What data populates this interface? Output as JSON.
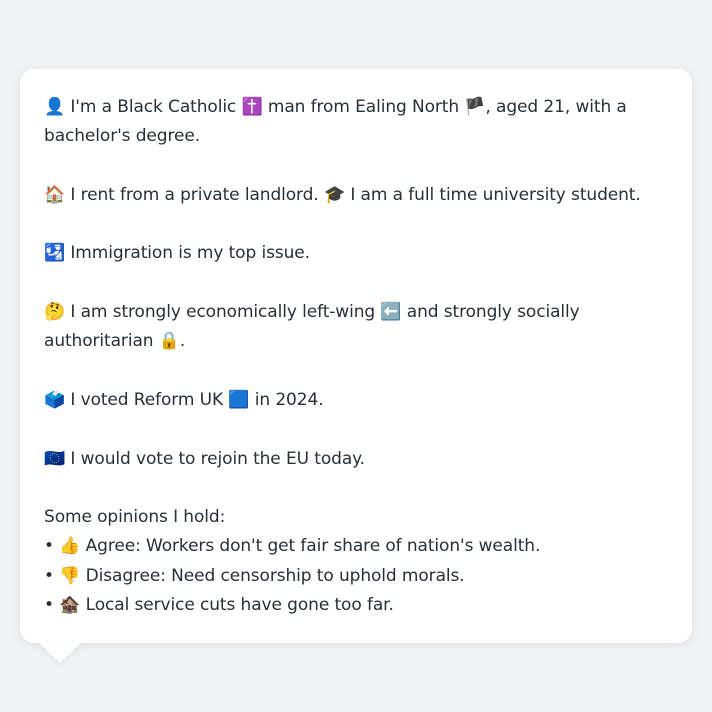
{
  "bio": {
    "line1_icon": "👤",
    "line1_a": "I'm a Black Catholic",
    "line1_icon2": "✝️",
    "line1_b": "man from Ealing North",
    "line1_icon3": "🏴",
    "line1_c": ", aged 21, with a bachelor's degree."
  },
  "housing": {
    "icon": "🏠",
    "text_a": "I rent from a private landlord.",
    "icon2": "🎓",
    "text_b": "I am a full time university student."
  },
  "issue": {
    "icon": "🛂",
    "text": "Immigration is my top issue."
  },
  "politics": {
    "icon": "🤔",
    "text_a": "I am strongly economically left-wing",
    "icon2": "⬅️",
    "text_b": "and strongly socially authoritarian",
    "icon3": "🔒",
    "text_c": "."
  },
  "vote": {
    "icon": "🗳️",
    "text_a": "I voted Reform UK",
    "icon2": "🟦",
    "text_b": "in 2024."
  },
  "eu": {
    "icon": "🇪🇺",
    "text": "I would vote to rejoin the EU today."
  },
  "opinions": {
    "heading": "Some opinions I hold:",
    "items": [
      {
        "bullet": "•",
        "icon": "👍",
        "text": "Agree: Workers don't get fair share of nation's wealth."
      },
      {
        "bullet": "•",
        "icon": "👎",
        "text": "Disagree: Need censorship to uphold morals."
      },
      {
        "bullet": "•",
        "icon": "🏚️",
        "text": "Local service cuts have gone too far."
      }
    ]
  }
}
